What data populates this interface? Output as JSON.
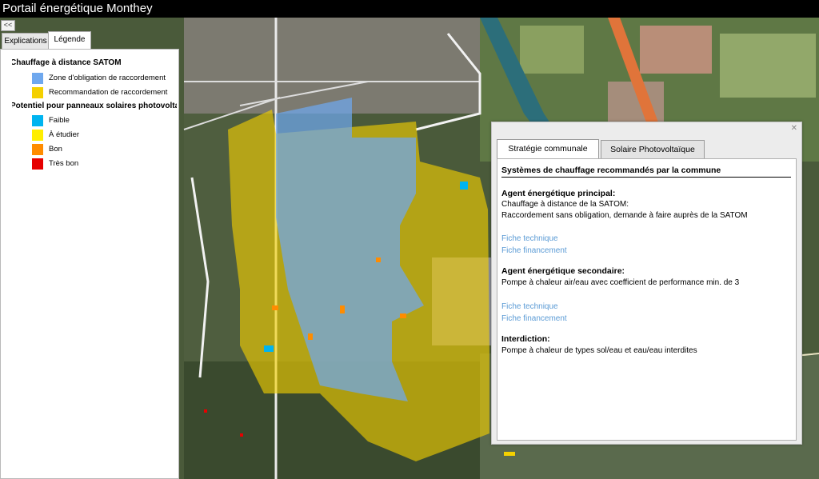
{
  "window": {
    "title": "Portail énergétique Monthey"
  },
  "sidebar": {
    "collapse_label": "<<",
    "tabs": [
      {
        "label": "Explications"
      },
      {
        "label": "Légende"
      }
    ],
    "active_tab": "Légende",
    "groups": [
      {
        "title": "Chauffage à distance SATOM",
        "items": [
          {
            "label": "Zone d'obligation de raccordement",
            "color": "#6fa8ee"
          },
          {
            "label": "Recommandation de raccordement",
            "color": "#f4d000"
          }
        ]
      },
      {
        "title": "Potentiel pour panneaux solaires photovoltaïques",
        "items": [
          {
            "label": "Faible",
            "color": "#00b4f0"
          },
          {
            "label": "À étudier",
            "color": "#ffee00"
          },
          {
            "label": "Bon",
            "color": "#ff8c00"
          },
          {
            "label": "Très bon",
            "color": "#e60000"
          }
        ]
      }
    ]
  },
  "popup": {
    "close_icon": "close-icon",
    "tabs": [
      {
        "label": "Stratégie communale"
      },
      {
        "label": "Solaire Photovoltaïque"
      }
    ],
    "active_tab": "Stratégie communale",
    "title": "Systèmes de chauffage recommandés par la commune",
    "principal": {
      "heading": "Agent énergétique principal:",
      "line1": "Chauffage à distance de la SATOM:",
      "line2": "Raccordement sans obligation, demande à faire auprès de la SATOM",
      "link1": "Fiche technique",
      "link2": "Fiche financement"
    },
    "secondaire": {
      "heading": "Agent énergétique secondaire:",
      "line1": "Pompe à chaleur air/eau avec coefficient de performance min. de 3",
      "link1": "Fiche technique",
      "link2": "Fiche financement"
    },
    "interdiction": {
      "heading": "Interdiction:",
      "line1": "Pompe à chaleur de types sol/eau et eau/eau interdites"
    }
  },
  "colors": {
    "obligation_zone": "#6fa8ee",
    "recommendation_zone": "#f4d000",
    "link": "#5b9bd5"
  }
}
